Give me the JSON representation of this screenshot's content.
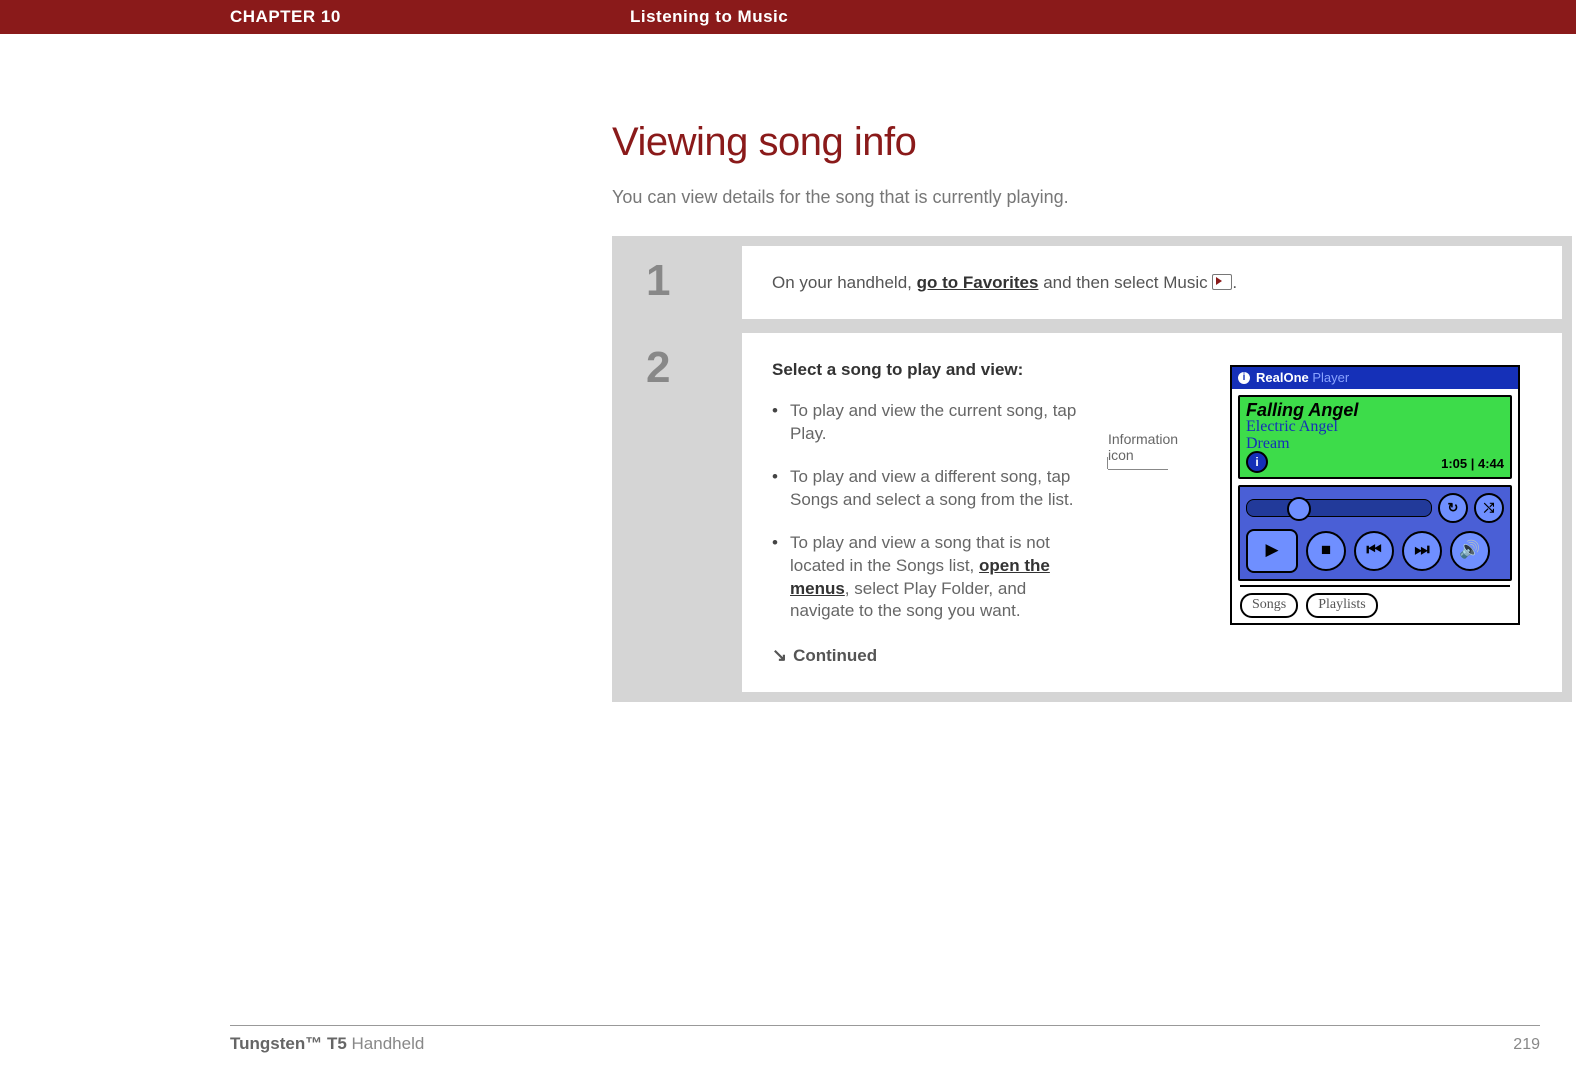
{
  "header": {
    "chapter_label": "CHAPTER 10",
    "chapter_title": "Listening to Music"
  },
  "main": {
    "title": "Viewing song info",
    "intro": "You can view details for the song that is currently playing.",
    "steps": {
      "one": {
        "number": "1",
        "prefix": "On your handheld, ",
        "link": "go to Favorites",
        "mid": " and then select Music ",
        "suffix": "."
      },
      "two": {
        "number": "2",
        "heading": "Select a song to play and view:",
        "bullets": {
          "b1": "To play and view the current song, tap Play.",
          "b2": "To play and view a different song, tap Songs and select a song from the list.",
          "b3_pre": "To play and view a song that is not located in the Songs list, ",
          "b3_link": "open the menus",
          "b3_post": ", select Play Folder, and navigate to the song you want."
        },
        "continued": "Continued"
      }
    },
    "callout": {
      "label_line1": "Information",
      "label_line2": "icon"
    },
    "player": {
      "titlebar_info_glyph": "i",
      "app_name_strong": "RealOne",
      "app_name_muted": " Player",
      "song_title": "Falling Angel",
      "artist": "Electric Angel",
      "album": "Dream",
      "info_icon_glyph": "i",
      "time": "1:05 | 4:44",
      "repeat_glyph": "↻",
      "shuffle_glyph": "⤭",
      "play_glyph": "▶",
      "stop_glyph": "■",
      "prev_glyph": "⏮",
      "next_glyph": "⏭",
      "vol_glyph": "🔊",
      "tab_songs": "Songs",
      "tab_playlists": "Playlists"
    }
  },
  "footer": {
    "product_strong": "Tungsten™ T5",
    "product_rest": " Handheld",
    "page_number": "219"
  }
}
